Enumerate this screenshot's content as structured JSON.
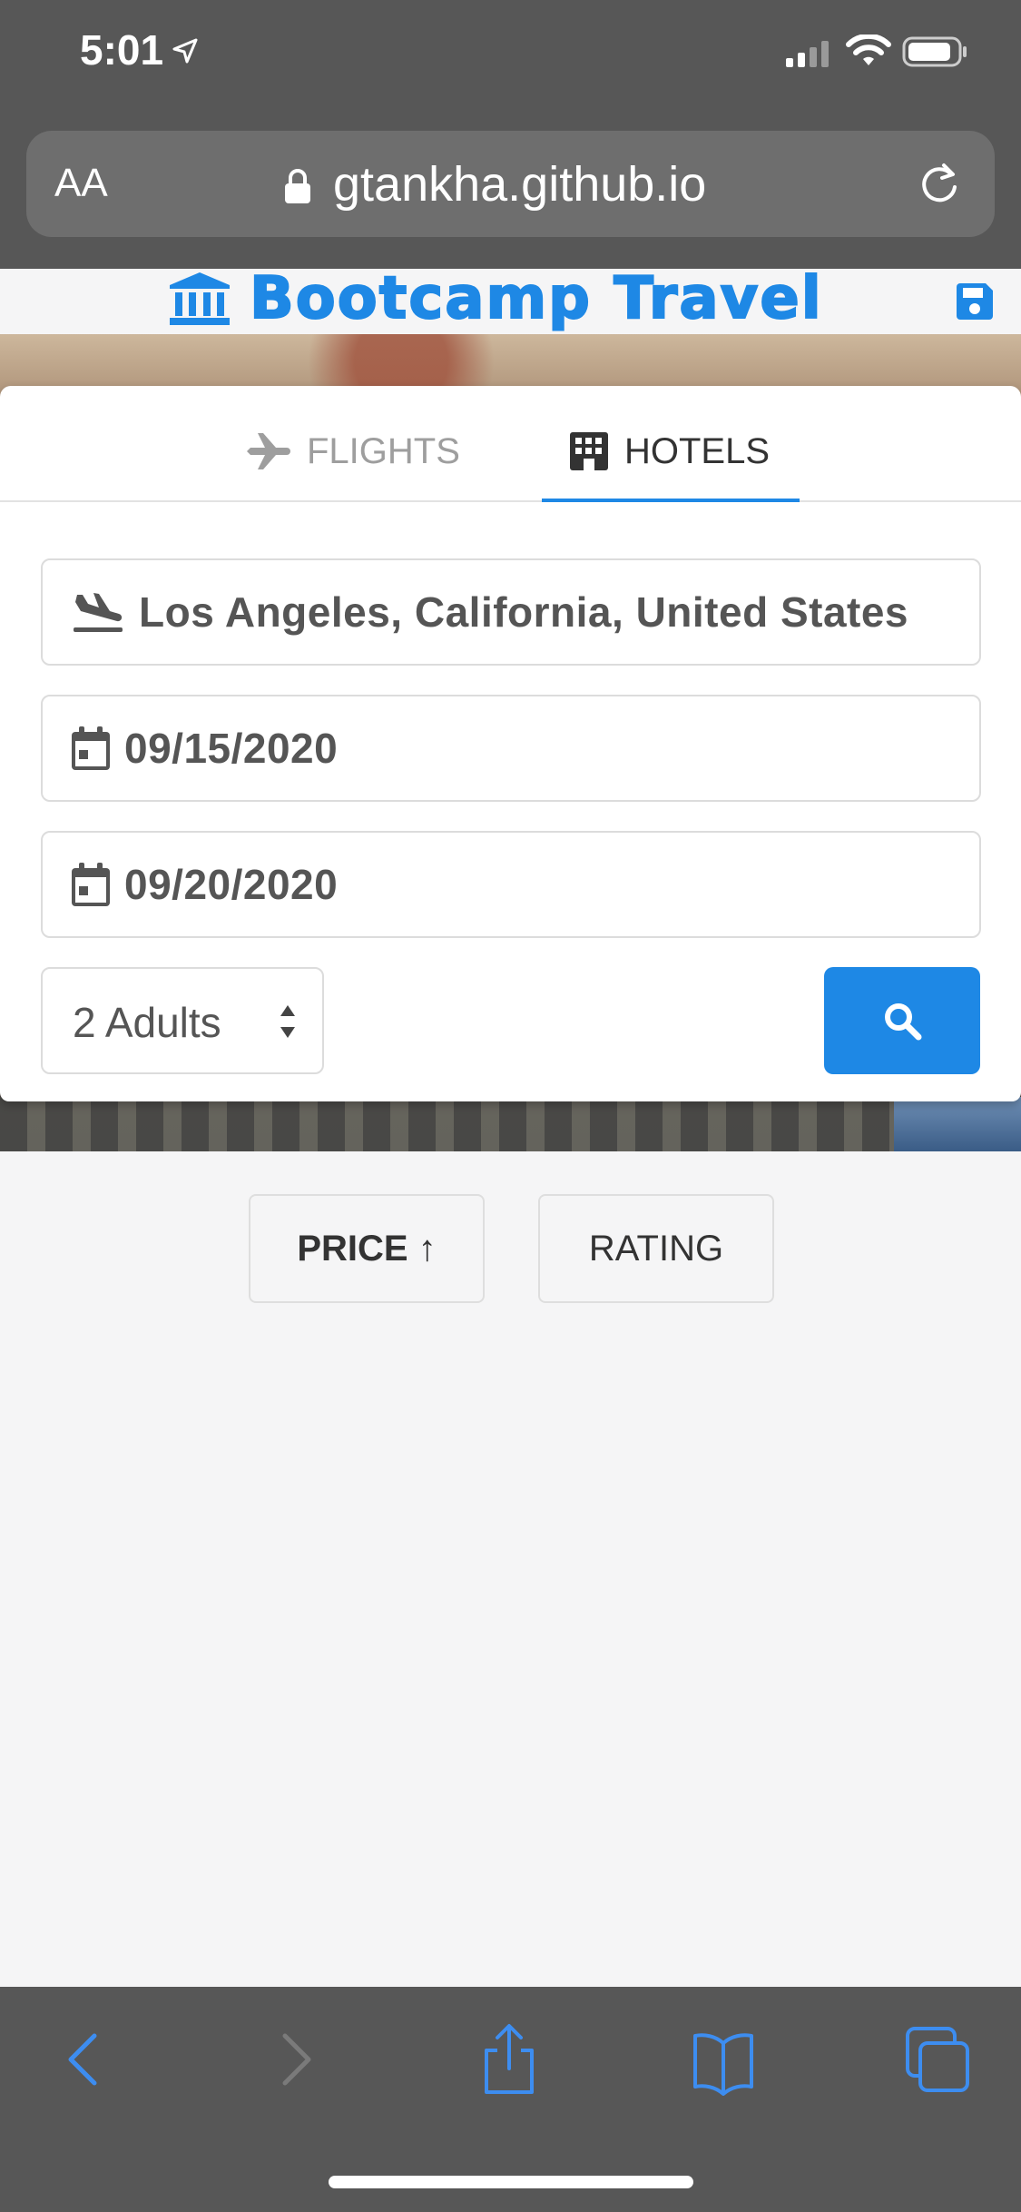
{
  "status_bar": {
    "time": "5:01"
  },
  "browser": {
    "text_size_label": "AA",
    "url": "gtankha.github.io"
  },
  "header": {
    "brand": "Bootcamp Travel"
  },
  "tabs": [
    {
      "label": "FLIGHTS",
      "active": false
    },
    {
      "label": "HOTELS",
      "active": true
    }
  ],
  "form": {
    "destination": "Los Angeles, California, United States",
    "check_in": "09/15/2020",
    "check_out": "09/20/2020",
    "guests": "2 Adults"
  },
  "sort": {
    "price_label": "PRICE ↑",
    "rating_label": "RATING"
  },
  "colors": {
    "accent": "#1e88e5",
    "chrome": "#575757",
    "background": "#f5f5f6"
  }
}
